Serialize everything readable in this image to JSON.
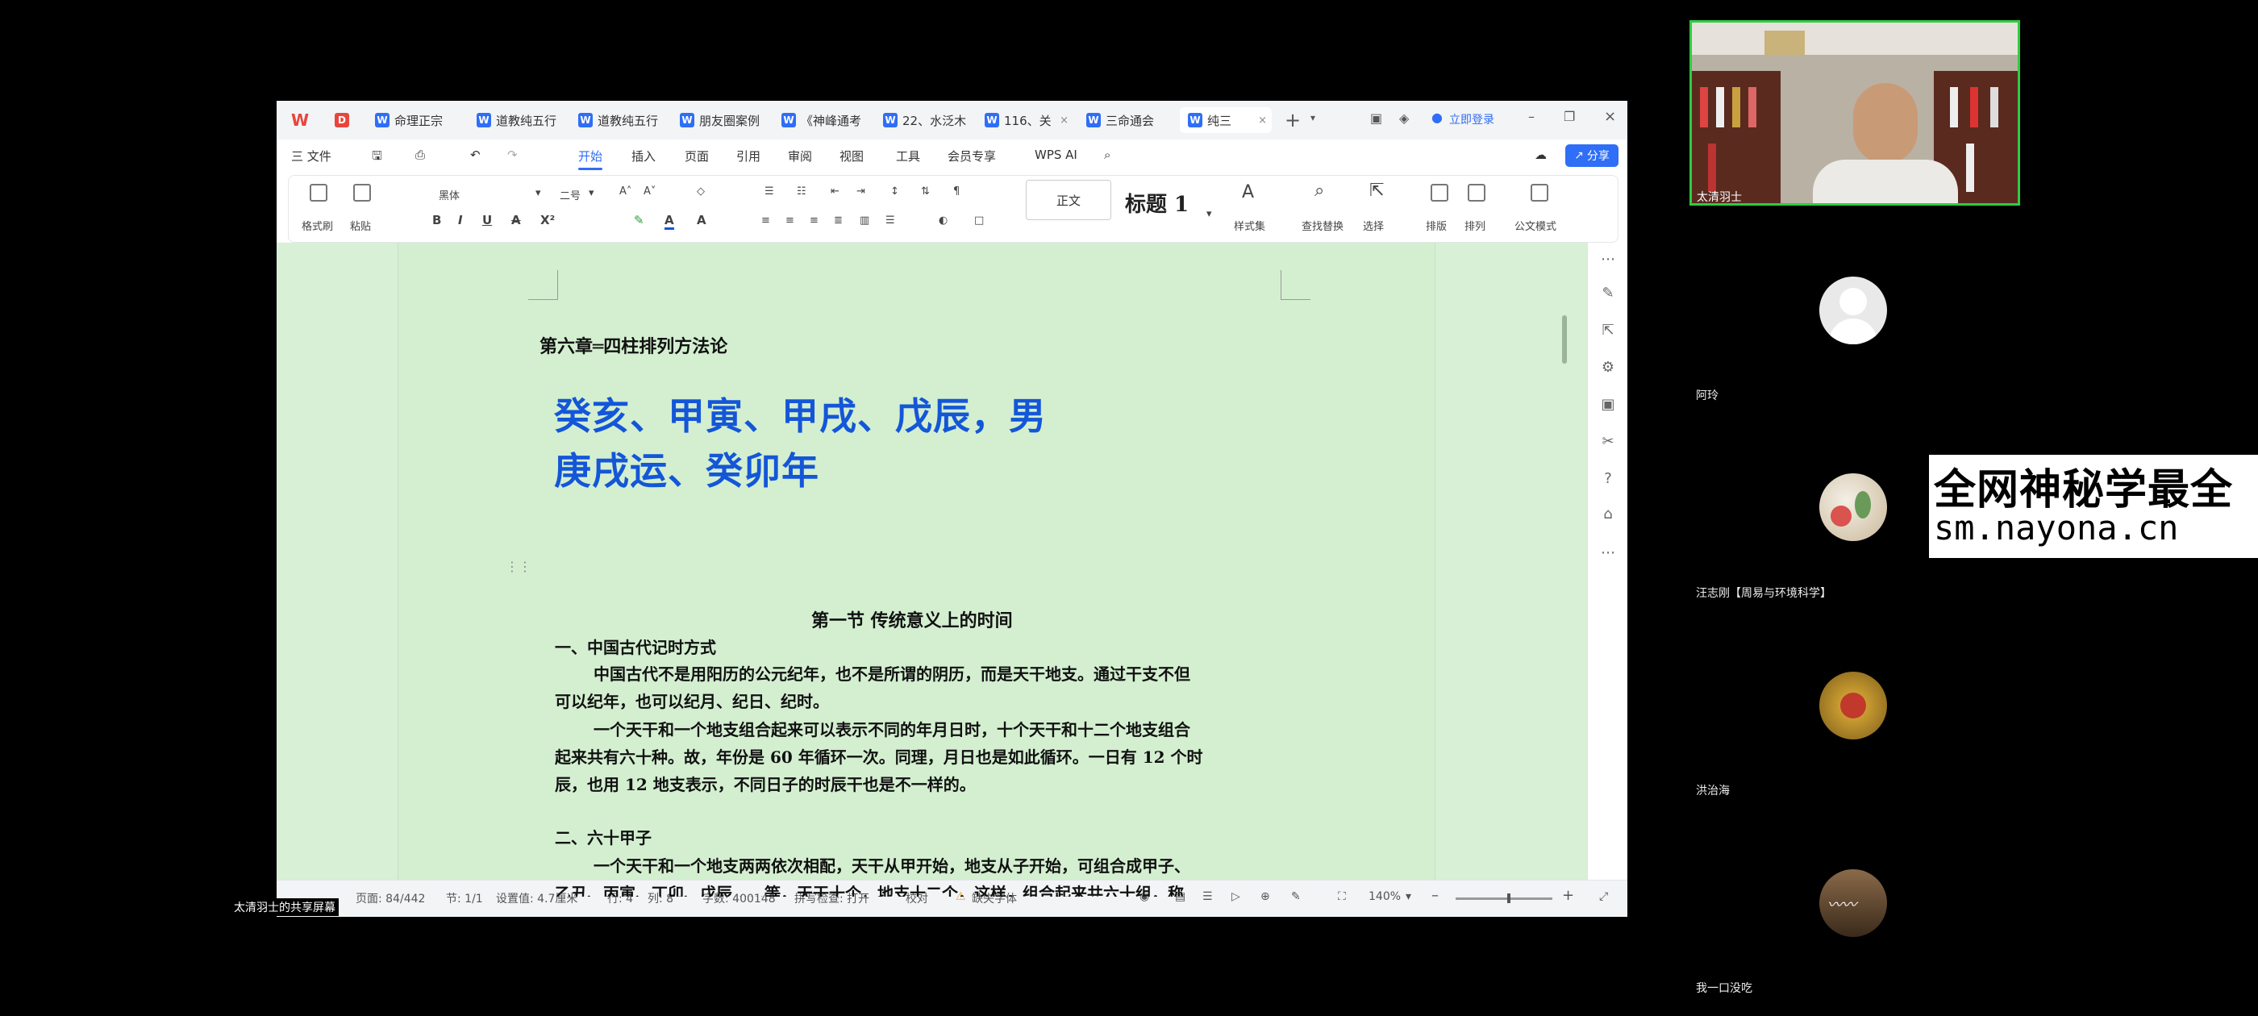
{
  "wps": {
    "tabs": [
      {
        "label": "命理正宗",
        "icon": "wps-doc-icon"
      },
      {
        "label": "道教纯五行",
        "icon": "wps-doc-icon"
      },
      {
        "label": "道教纯五行",
        "icon": "wps-doc-icon"
      },
      {
        "label": "朋友圈案例",
        "icon": "wps-doc-icon"
      },
      {
        "label": "《神峰通考",
        "icon": "wps-doc-icon"
      },
      {
        "label": "22、水泛木",
        "icon": "wps-doc-icon"
      },
      {
        "label": "116、关",
        "icon": "wps-doc-icon"
      },
      {
        "label": "三命通会",
        "icon": "wps-doc-icon"
      },
      {
        "label": "纯三",
        "icon": "wps-doc-icon"
      }
    ],
    "login_label": "立即登录",
    "share_label": "分享",
    "menu": {
      "file": "三 文件",
      "items": [
        "开始",
        "插入",
        "页面",
        "引用",
        "审阅",
        "视图",
        "工具",
        "会员专享"
      ],
      "ai": "WPS AI"
    },
    "ribbon": {
      "format_painter": "格式刷",
      "paste": "粘贴",
      "font_name": "黑体",
      "font_size": "二号",
      "style_normal": "正文",
      "style_heading": "标题 1",
      "style_set": "样式集",
      "find_replace": "查找替换",
      "select": "选择",
      "layout": "排版",
      "arrange": "排列",
      "official_mode": "公文模式"
    },
    "status": {
      "page": "页面: 84/442",
      "section": "节: 1/1",
      "setting": "设置值: 4.7厘米",
      "row": "行: 4",
      "col": "列: 8",
      "words": "字数: 400148",
      "spell": "拼写检查: 打开",
      "proof": "校对",
      "missing_font": "缺失字体",
      "zoom": "140%"
    }
  },
  "document": {
    "chapter_title": "第六章═四柱排列方法论",
    "big_line1": "癸亥、甲寅、甲戌、戊辰，男",
    "big_line2": "庚戌运、癸卯年",
    "section_title": "第一节 传统意义上的时间",
    "h1": "一、中国古代记时方式",
    "p1a": "中国古代不是用阳历的公元纪年，也不是所谓的阴历，而是天干地支。通过干支不但",
    "p1b": "可以纪年，也可以纪月、纪日、纪时。",
    "p2a": "一个天干和一个地支组合起来可以表示不同的年月日时，十个天干和十二个地支组合",
    "p2b": "起来共有六十种。故，年份是 60 年循环一次。同理，月日也是如此循环。一日有 12 个时",
    "p2c": "辰，也用 12 地支表示，不同日子的时辰干也是不一样的。",
    "h2": "二、六十甲子",
    "p3a": "一个天干和一个地支两两依次相配，天干从甲开始，地支从子开始，可组合成甲子、",
    "p3b": "乙丑、丙寅、丁卯、戊辰……等，天干十个，地支十二个，这样，组合起来共六十组，称"
  },
  "screen_share_label": "太清羽士的共享屏幕",
  "participants": [
    {
      "name": "太清羽士",
      "type": "video"
    },
    {
      "name": "阿玲",
      "type": "avatar-default"
    },
    {
      "name": "汪志刚【周易与环境科学】",
      "type": "avatar-flower"
    },
    {
      "name": "洪治海",
      "type": "avatar-gold"
    },
    {
      "name": "我一口没吃",
      "type": "avatar-calligraphy"
    }
  ],
  "watermark": {
    "line1": "全网神秘学最全",
    "line2": "sm.nayona.cn"
  },
  "colors": {
    "accent": "#2f6ef6",
    "doc_background": "#d3efd0",
    "heading_blue": "#1456d8",
    "active_speaker_border": "#2ecc40"
  }
}
